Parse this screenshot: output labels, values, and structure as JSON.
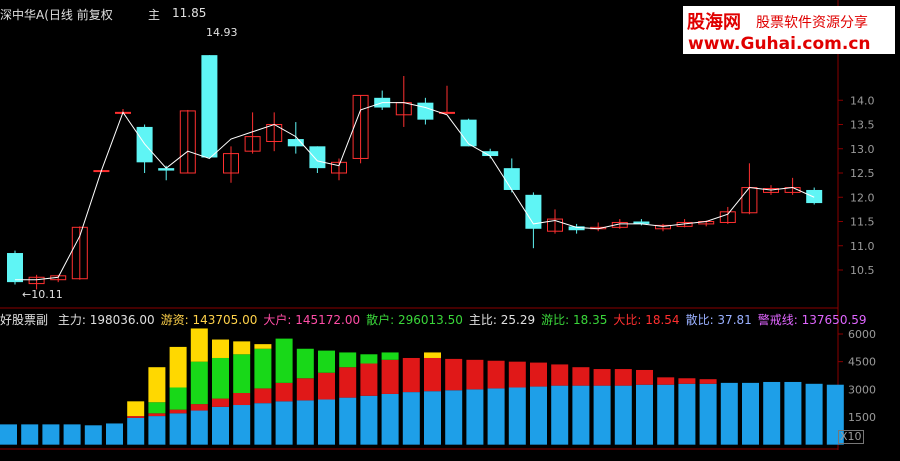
{
  "header": {
    "title": "深中华A(日线 前复权",
    "main_label": "主",
    "main_value": "11.85"
  },
  "watermark": {
    "logo": "股海网",
    "tagline": "股票软件资源分享",
    "url": "www.Guhai.com.cn"
  },
  "annotations": {
    "high_label": "14.93",
    "low_label": "←10.11"
  },
  "price_axis": {
    "ticks": [
      "14.0",
      "13.5",
      "13.0",
      "12.5",
      "12.0",
      "11.5",
      "11.0",
      "10.5"
    ]
  },
  "volume_axis": {
    "ticks": [
      "6000",
      "4500",
      "3000",
      "1500"
    ],
    "scale_label": "X10"
  },
  "indicator": {
    "name": "好股票副",
    "items": [
      {
        "label": "主力:",
        "value": "198036.00",
        "color": "#e0e0e0"
      },
      {
        "label": "游资:",
        "value": "143705.00",
        "color": "#ffd24a"
      },
      {
        "label": "大户:",
        "value": "145172.00",
        "color": "#ff4da6"
      },
      {
        "label": "散户:",
        "value": "296013.50",
        "color": "#3ad63a"
      },
      {
        "label": "主比:",
        "value": "25.29",
        "color": "#e0e0e0"
      },
      {
        "label": "游比:",
        "value": "18.35",
        "color": "#3ad63a"
      },
      {
        "label": "大比:",
        "value": "18.54",
        "color": "#ff3030"
      },
      {
        "label": "散比:",
        "value": "37.81",
        "color": "#9ab0ff"
      },
      {
        "label": "警戒线:",
        "value": "137650.59",
        "color": "#e066ff"
      }
    ]
  },
  "colors": {
    "up": "#ff3030",
    "down": "#5ff5f5",
    "ma": "#ffffff",
    "blue": "#1e9fe8",
    "red": "#e01818",
    "green": "#18d818",
    "yellow": "#ffd800"
  },
  "chart_data": [
    {
      "type": "candlestick",
      "title": "",
      "ylim": [
        10.0,
        15.0
      ],
      "candles": [
        {
          "o": 10.85,
          "c": 10.25,
          "h": 10.9,
          "l": 10.2
        },
        {
          "o": 10.22,
          "c": 10.35,
          "h": 10.4,
          "l": 10.1
        },
        {
          "o": 10.3,
          "c": 10.38,
          "h": 10.4,
          "l": 10.25
        },
        {
          "o": 10.32,
          "c": 11.38,
          "h": 11.4,
          "l": 10.3
        },
        {
          "o": 12.55,
          "c": 12.55,
          "h": 12.55,
          "l": 12.55
        },
        {
          "o": 13.75,
          "c": 13.75,
          "h": 13.82,
          "l": 13.75
        },
        {
          "o": 13.45,
          "c": 12.72,
          "h": 13.5,
          "l": 12.5
        },
        {
          "o": 12.6,
          "c": 12.55,
          "h": 12.65,
          "l": 12.35
        },
        {
          "o": 12.5,
          "c": 13.78,
          "h": 13.8,
          "l": 12.5
        },
        {
          "o": 14.93,
          "c": 12.82,
          "h": 14.93,
          "l": 12.8
        },
        {
          "o": 12.5,
          "c": 12.9,
          "h": 13.05,
          "l": 12.3
        },
        {
          "o": 12.95,
          "c": 13.25,
          "h": 13.75,
          "l": 12.9
        },
        {
          "o": 13.15,
          "c": 13.5,
          "h": 13.75,
          "l": 12.95
        },
        {
          "o": 13.2,
          "c": 13.05,
          "h": 13.55,
          "l": 12.9
        },
        {
          "o": 13.05,
          "c": 12.6,
          "h": 13.05,
          "l": 12.5
        },
        {
          "o": 12.5,
          "c": 12.72,
          "h": 12.8,
          "l": 12.35
        },
        {
          "o": 12.8,
          "c": 14.1,
          "h": 14.1,
          "l": 12.7
        },
        {
          "o": 14.05,
          "c": 13.85,
          "h": 14.2,
          "l": 13.8
        },
        {
          "o": 13.7,
          "c": 13.95,
          "h": 14.5,
          "l": 13.45
        },
        {
          "o": 13.95,
          "c": 13.6,
          "h": 14.05,
          "l": 13.5
        },
        {
          "o": 13.75,
          "c": 13.75,
          "h": 14.3,
          "l": 13.75
        },
        {
          "o": 13.6,
          "c": 13.05,
          "h": 13.62,
          "l": 13.05
        },
        {
          "o": 12.95,
          "c": 12.85,
          "h": 13.0,
          "l": 12.8
        },
        {
          "o": 12.6,
          "c": 12.15,
          "h": 12.8,
          "l": 12.1
        },
        {
          "o": 12.05,
          "c": 11.35,
          "h": 12.1,
          "l": 10.95
        },
        {
          "o": 11.3,
          "c": 11.55,
          "h": 11.75,
          "l": 11.25
        },
        {
          "o": 11.4,
          "c": 11.32,
          "h": 11.45,
          "l": 11.25
        },
        {
          "o": 11.35,
          "c": 11.38,
          "h": 11.48,
          "l": 11.3
        },
        {
          "o": 11.38,
          "c": 11.48,
          "h": 11.55,
          "l": 11.35
        },
        {
          "o": 11.5,
          "c": 11.45,
          "h": 11.55,
          "l": 11.42
        },
        {
          "o": 11.35,
          "c": 11.42,
          "h": 11.45,
          "l": 11.3
        },
        {
          "o": 11.4,
          "c": 11.48,
          "h": 11.55,
          "l": 11.38
        },
        {
          "o": 11.45,
          "c": 11.5,
          "h": 11.52,
          "l": 11.4
        },
        {
          "o": 11.48,
          "c": 11.7,
          "h": 11.8,
          "l": 11.45
        },
        {
          "o": 11.68,
          "c": 12.2,
          "h": 12.7,
          "l": 11.65
        },
        {
          "o": 12.1,
          "c": 12.18,
          "h": 12.25,
          "l": 12.05
        },
        {
          "o": 12.1,
          "c": 12.2,
          "h": 12.4,
          "l": 12.05
        },
        {
          "o": 12.15,
          "c": 11.88,
          "h": 12.2,
          "l": 11.85
        }
      ],
      "ma_line": [
        10.3,
        10.3,
        10.35,
        11.2,
        12.55,
        13.75,
        13.1,
        12.6,
        12.95,
        12.8,
        13.2,
        13.35,
        13.5,
        13.25,
        12.75,
        12.65,
        13.8,
        13.95,
        13.95,
        13.85,
        13.7,
        13.1,
        12.85,
        12.15,
        11.45,
        11.52,
        11.38,
        11.35,
        11.45,
        11.45,
        11.4,
        11.45,
        11.5,
        11.65,
        12.2,
        12.15,
        12.2,
        12.0
      ],
      "annotations": [
        {
          "text": "14.93",
          "y": 14.93
        },
        {
          "text": "10.11",
          "y": 10.11
        }
      ]
    },
    {
      "type": "bar",
      "stacked": true,
      "title": "",
      "ylim": [
        0,
        6700
      ],
      "series": [
        {
          "values": [
            1100,
            1100,
            1100,
            1100,
            1050,
            1150,
            1450,
            1550,
            1700,
            1850,
            2050,
            2150,
            2250,
            2350,
            2400,
            2450,
            2550,
            2650,
            2750,
            2850,
            2900,
            2950,
            3000,
            3050,
            3100,
            3150,
            3200,
            3200,
            3200,
            3200,
            3250,
            3250,
            3300,
            3300,
            3350,
            3350,
            3400,
            3400,
            3300,
            3250
          ]
        },
        {
          "values": [
            0,
            0,
            0,
            0,
            0,
            0,
            100,
            150,
            200,
            350,
            450,
            650,
            800,
            1000,
            1200,
            1450,
            1650,
            1750,
            1850,
            1850,
            1800,
            1700,
            1600,
            1500,
            1400,
            1300,
            1150,
            1000,
            900,
            900,
            800,
            400,
            300,
            250,
            0,
            0,
            0,
            0,
            0,
            0
          ]
        },
        {
          "values": [
            0,
            0,
            0,
            0,
            0,
            0,
            0,
            600,
            1200,
            2300,
            2200,
            2100,
            2150,
            2400,
            1600,
            1200,
            800,
            500,
            400,
            0,
            0,
            0,
            0,
            0,
            0,
            0,
            0,
            0,
            0,
            0,
            0,
            0,
            0,
            0,
            0,
            0,
            0,
            0,
            0,
            0
          ]
        },
        {
          "values": [
            0,
            0,
            0,
            0,
            0,
            0,
            800,
            1900,
            2200,
            1800,
            1000,
            700,
            250,
            0,
            0,
            0,
            0,
            0,
            0,
            0,
            300,
            0,
            0,
            0,
            0,
            0,
            0,
            0,
            0,
            0,
            0,
            0,
            0,
            0,
            0,
            0,
            0,
            0,
            0,
            0
          ]
        }
      ]
    }
  ]
}
